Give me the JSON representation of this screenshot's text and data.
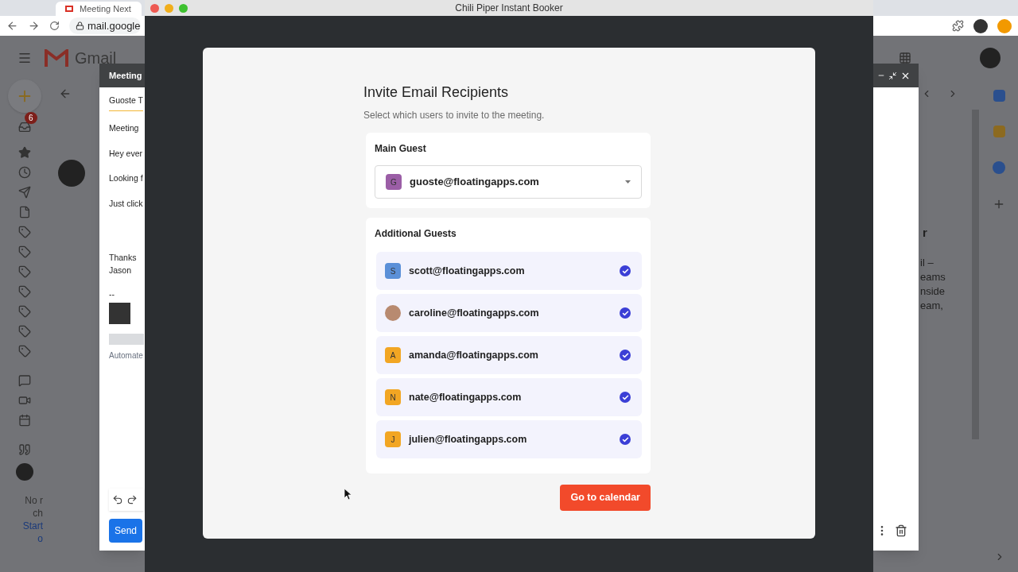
{
  "browser": {
    "tab_title": "Meeting Next",
    "url": "mail.google"
  },
  "gmail": {
    "logo_text": "Gmail",
    "inbox_badge": "6",
    "footer_lines": [
      "No r",
      "ch"
    ],
    "footer_links": [
      "Start",
      "o"
    ],
    "reading_pane_lines": [
      "r",
      "il –",
      "eams",
      "nside",
      "eam,"
    ]
  },
  "compose": {
    "title": "Meeting",
    "to": "Guoste T",
    "subject": "Meeting",
    "body_lines": [
      "Hey ever",
      "Looking f",
      "Just click"
    ],
    "closing_lines": [
      "Thanks",
      "Jason"
    ],
    "signature_separator": "--",
    "footer_text": "Automate",
    "send_label": "Send"
  },
  "app_window": {
    "title": "Chili Piper Instant Booker",
    "heading": "Invite Email Recipients",
    "subtitle": "Select which users to invite to the meeting.",
    "main_guest": {
      "label": "Main Guest",
      "initial": "G",
      "color": "#9b5ea6",
      "email": "guoste@floatingapps.com"
    },
    "additional_guests": {
      "label": "Additional Guests",
      "guests": [
        {
          "kind": "initial",
          "initial": "S",
          "color": "#5b90d8",
          "email": "scott@floatingapps.com",
          "checked": true
        },
        {
          "kind": "photo",
          "email": "caroline@floatingapps.com",
          "checked": true
        },
        {
          "kind": "initial",
          "initial": "A",
          "color": "#f2a623",
          "email": "amanda@floatingapps.com",
          "checked": true
        },
        {
          "kind": "initial",
          "initial": "N",
          "color": "#f2a623",
          "email": "nate@floatingapps.com",
          "checked": true
        },
        {
          "kind": "initial",
          "initial": "J",
          "color": "#f2a623",
          "email": "julien@floatingapps.com",
          "checked": true
        }
      ]
    },
    "primary_button": "Go to calendar"
  }
}
